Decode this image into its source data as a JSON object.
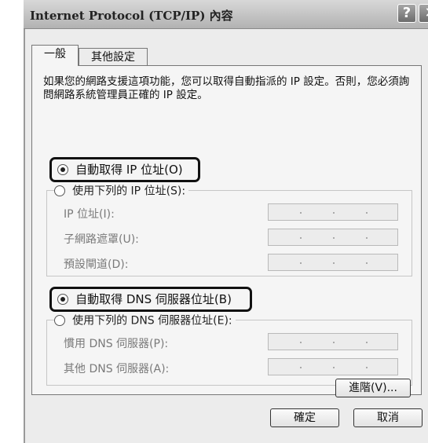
{
  "window": {
    "title": "Internet Protocol (TCP/IP) 內容",
    "help_glyph": "?",
    "close_glyph": "✕"
  },
  "tabs": [
    {
      "label": "一般",
      "selected": true
    },
    {
      "label": "其他設定",
      "selected": false
    }
  ],
  "description": "如果您的網路支援這項功能，您可以取得自動指派的 IP 設定。否則，您必須詢問網路系統管理員正確的 IP 設定。",
  "ip_section": {
    "auto_label": "自動取得 IP 位址(O)",
    "manual_label": "使用下列的 IP 位址(S):",
    "auto_selected": true,
    "fields": [
      {
        "label": "IP 位址(I):"
      },
      {
        "label": "子網路遮罩(U):"
      },
      {
        "label": "預設閘道(D):"
      }
    ]
  },
  "dns_section": {
    "auto_label": "自動取得 DNS 伺服器位址(B)",
    "manual_label": "使用下列的 DNS 伺服器位址(E):",
    "auto_selected": true,
    "fields": [
      {
        "label": "慣用 DNS 伺服器(P):"
      },
      {
        "label": "其他 DNS 伺服器(A):"
      }
    ]
  },
  "buttons": {
    "advanced": "進階(V)...",
    "ok": "確定",
    "cancel": "取消"
  }
}
